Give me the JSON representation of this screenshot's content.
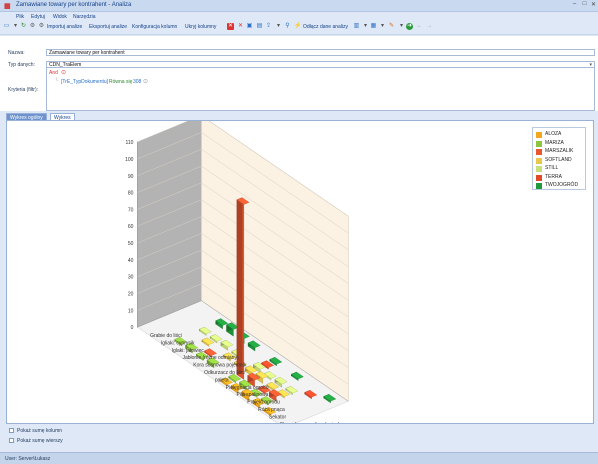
{
  "window": {
    "title": "Zamawiane towary per kontrahent - Analiza",
    "icon": "analysis-app-icon"
  },
  "menu": [
    "Plik",
    "Edytuj",
    "Widok",
    "Narzędzia"
  ],
  "toolbar": {
    "import_label": "Importuj analize",
    "export_label": "Eksportuj analize",
    "config_label": "Konfiguracja kolumn",
    "hide_label": "Ukryj kolumny",
    "detach_label": "Odłącz dane analizy"
  },
  "form": {
    "name_label": "Nazwa:",
    "name_value": "Zamawiane towary per kontrahent",
    "type_label": "Typ danych:",
    "type_value": "CDN_TraElem",
    "criteria_label": "Kryteria (filtr):",
    "criteria_and": "And",
    "criteria_field": "[TrE_TypDokumentu]",
    "criteria_op": "Równa się",
    "criteria_value": "308"
  },
  "tabs": [
    "Wykres ogólny",
    "Wykres"
  ],
  "options": {
    "sum_columns": "Pokaż sumę kolumn",
    "sum_rows": "Pokaż sumę wierszy"
  },
  "status": {
    "user": "User: Server\\Łukasz"
  },
  "colors": {
    "accent": "#15428b",
    "bar_highlight": "#e8572f"
  },
  "chart_data": {
    "type": "bar",
    "style": "3d",
    "ylim": [
      0,
      110
    ],
    "y_ticks": [
      0,
      10,
      20,
      30,
      40,
      50,
      60,
      70,
      80,
      90,
      100,
      110
    ],
    "categories": [
      "Grabie do liści",
      "Igliaki: cyprysik",
      "Iglaki: jałowiec",
      "Jabłonie (różne odmiany)",
      "Kora sosnowa pojemnik",
      "Odkurzacz do liści",
      "paleta",
      "Pielęgnacja ogrodu",
      "Piła spalinowa",
      "Projekt ogrodu",
      "Róża pnąca",
      "Sekator",
      "Skrzynka na rodiny doniczkowe"
    ],
    "series": [
      {
        "name": "ALOZA",
        "color": "#f2a81d",
        "values": [
          0,
          0,
          0,
          0,
          0,
          0,
          0,
          1,
          2,
          3,
          2,
          1,
          0
        ]
      },
      {
        "name": "MARIZA",
        "color": "#8cc63e",
        "values": [
          0,
          0,
          1,
          2,
          1,
          2,
          0,
          1,
          2,
          1,
          1,
          0,
          0
        ]
      },
      {
        "name": "MARSZALIK",
        "color": "#e8572f",
        "values": [
          0,
          0,
          0,
          0,
          1,
          0,
          0,
          104,
          4,
          1,
          3,
          0,
          0
        ]
      },
      {
        "name": "SOFTLAND",
        "color": "#e8c84a",
        "values": [
          0,
          0,
          0,
          1,
          0,
          1,
          1,
          2,
          3,
          1,
          1,
          0,
          0
        ]
      },
      {
        "name": "STILL",
        "color": "#c9e07a",
        "values": [
          0,
          0,
          1,
          1,
          2,
          1,
          0,
          2,
          1,
          2,
          1,
          0,
          0
        ]
      },
      {
        "name": "TERRA",
        "color": "#e14a28",
        "values": [
          0,
          0,
          0,
          0,
          0,
          0,
          0,
          1,
          0,
          0,
          0,
          1,
          0
        ]
      },
      {
        "name": "TWOJOGRÓD",
        "color": "#1f9a3c",
        "values": [
          0,
          0,
          2,
          4,
          3,
          2,
          0,
          1,
          0,
          1,
          0,
          0,
          1
        ]
      }
    ]
  }
}
